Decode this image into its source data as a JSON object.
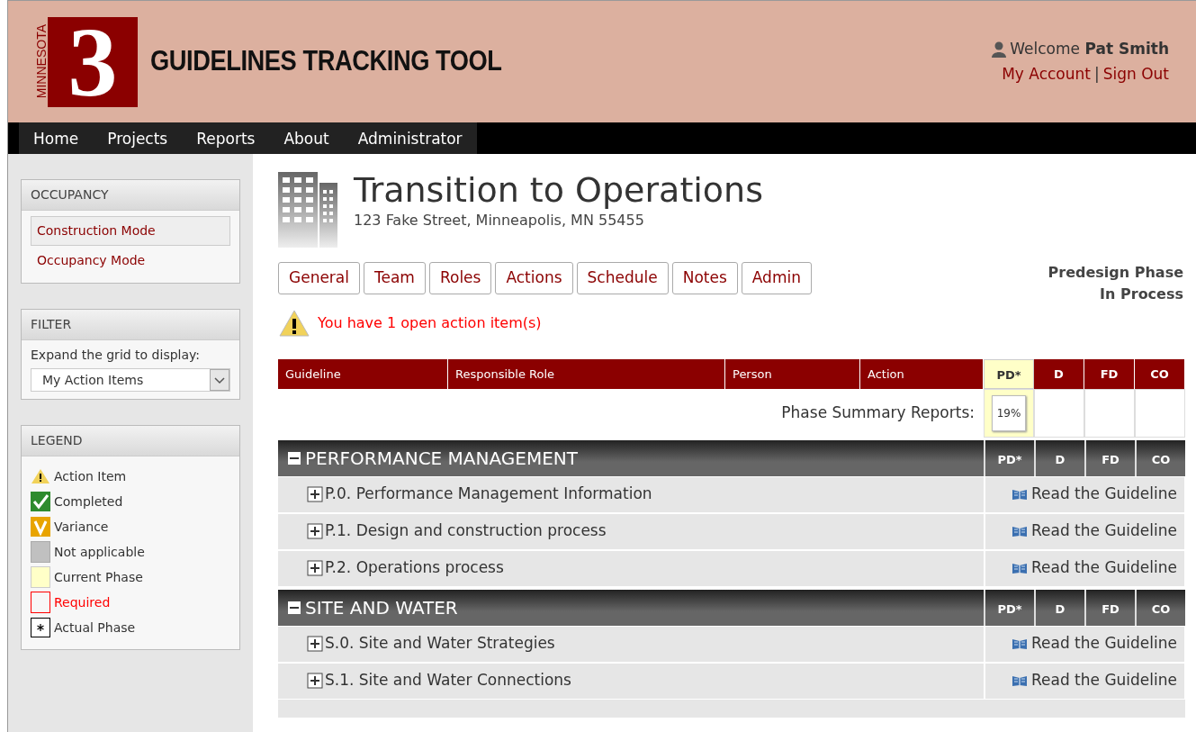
{
  "header": {
    "logo_side": "MINNESOTA",
    "logo_digit": "3",
    "title": "GUIDELINES TRACKING TOOL",
    "welcome": "Welcome",
    "user": "Pat Smith",
    "links": [
      "My Account",
      "Sign Out"
    ],
    "separator": "|"
  },
  "nav": {
    "items": [
      "Home",
      "Projects",
      "Reports",
      "About",
      "Administrator"
    ]
  },
  "sidebar": {
    "occupancy": {
      "title": "OCCUPANCY",
      "items": [
        {
          "label": "Construction Mode",
          "selected": true
        },
        {
          "label": "Occupancy Mode",
          "selected": false
        }
      ]
    },
    "filter": {
      "title": "FILTER",
      "label": "Expand the grid to display:",
      "value": "My Action Items"
    },
    "legend": {
      "title": "LEGEND",
      "items": [
        {
          "kind": "action",
          "label": "Action Item"
        },
        {
          "kind": "completed",
          "label": "Completed"
        },
        {
          "kind": "variance",
          "label": "Variance"
        },
        {
          "kind": "na",
          "label": "Not applicable"
        },
        {
          "kind": "current",
          "label": "Current Phase"
        },
        {
          "kind": "required",
          "label": "Required"
        },
        {
          "kind": "actual",
          "label": "Actual Phase"
        }
      ]
    }
  },
  "project": {
    "title": "Transition to Operations",
    "address": "123 Fake Street, Minneapolis, MN 55455",
    "tabs": [
      "General",
      "Team",
      "Roles",
      "Actions",
      "Schedule",
      "Notes",
      "Admin"
    ],
    "phase": "Predesign Phase",
    "status": "In Process",
    "alert": "You have 1 open action item(s)"
  },
  "grid": {
    "columns": [
      "Guideline",
      "Responsible Role",
      "Person",
      "Action"
    ],
    "phases": [
      {
        "label": "PD*",
        "current": true
      },
      {
        "label": "D",
        "current": false
      },
      {
        "label": "FD",
        "current": false
      },
      {
        "label": "CO",
        "current": false
      }
    ],
    "summary_label": "Phase Summary Reports:",
    "summary_reports": [
      "19%"
    ],
    "sections": [
      {
        "title": "PERFORMANCE MANAGEMENT",
        "expanded": true,
        "phases": [
          "PD*",
          "D",
          "FD",
          "CO"
        ],
        "rows": [
          {
            "label": "P.0. Performance Management Information",
            "expanded": false,
            "link": "Read the Guideline"
          },
          {
            "label": "P.1. Design and construction process",
            "expanded": false,
            "link": "Read the Guideline"
          },
          {
            "label": "P.2. Operations process",
            "expanded": false,
            "link": "Read the Guideline"
          }
        ]
      },
      {
        "title": "SITE AND WATER",
        "expanded": true,
        "phases": [
          "PD*",
          "D",
          "FD",
          "CO"
        ],
        "rows": [
          {
            "label": "S.0. Site and Water Strategies",
            "expanded": false,
            "link": "Read the Guideline"
          },
          {
            "label": "S.1. Site and Water Connections",
            "expanded": false,
            "link": "Read the Guideline"
          }
        ]
      }
    ]
  }
}
